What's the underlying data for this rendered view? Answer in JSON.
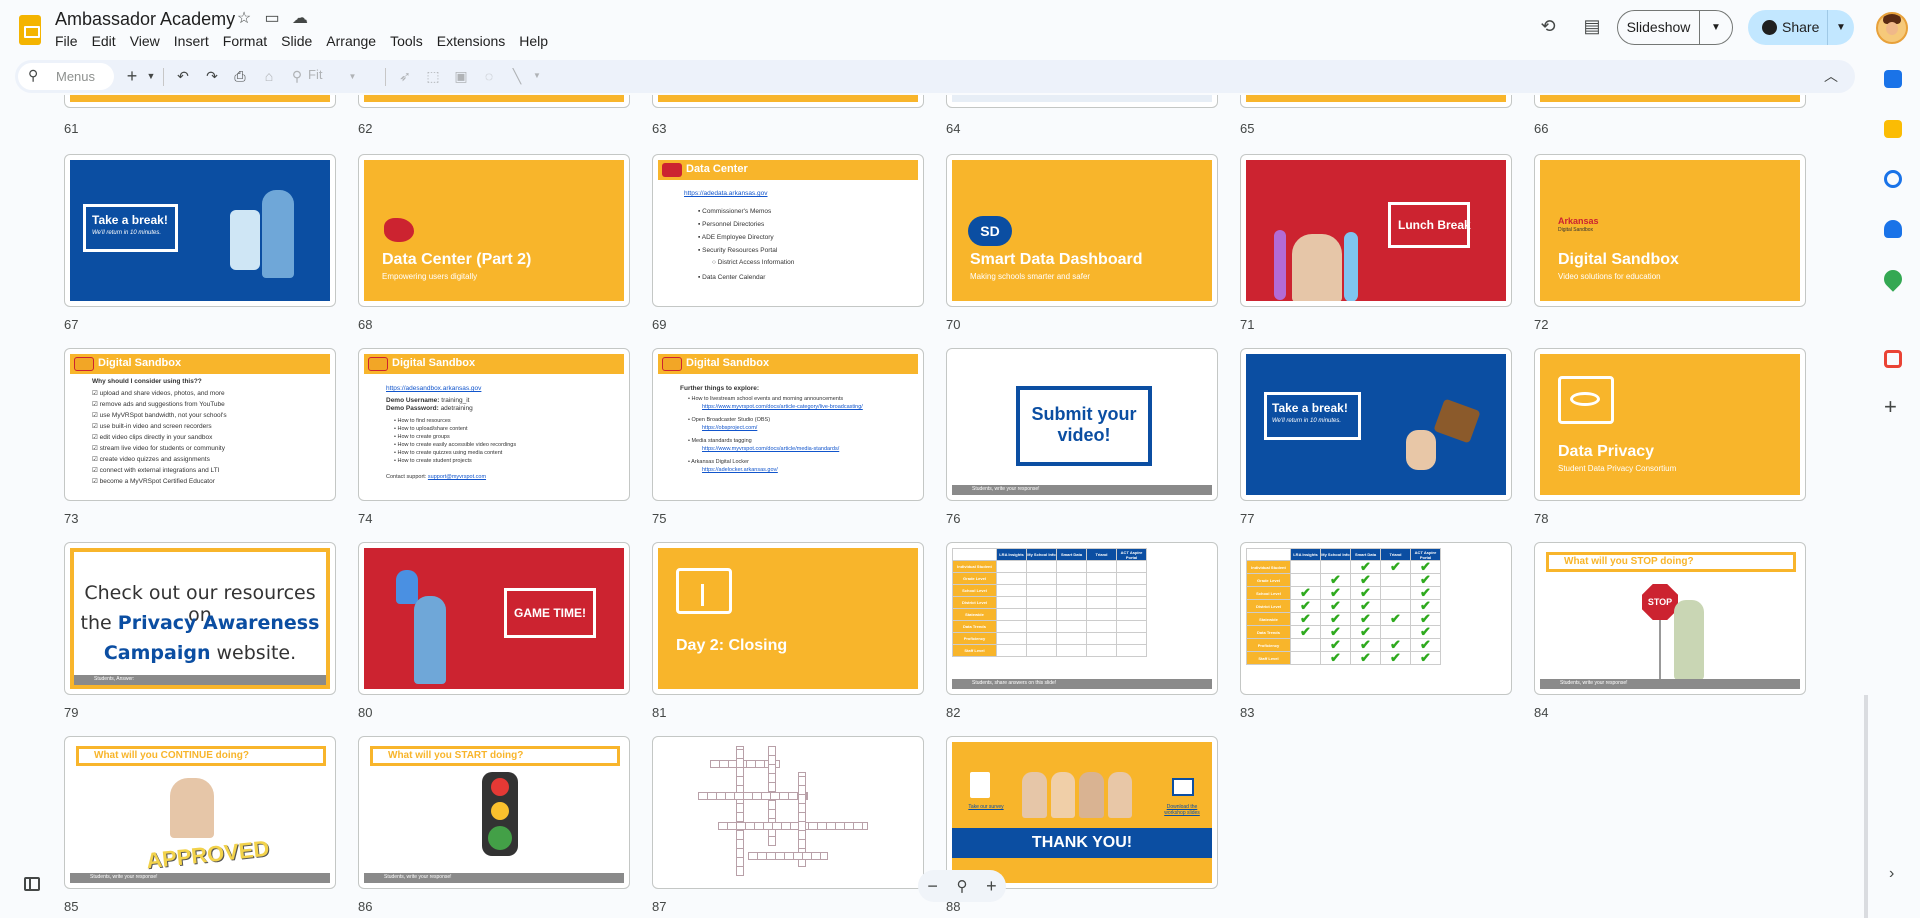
{
  "document": {
    "title": "Ambassador Academy"
  },
  "menubar": [
    "File",
    "Edit",
    "View",
    "Insert",
    "Format",
    "Slide",
    "Arrange",
    "Tools",
    "Extensions",
    "Help"
  ],
  "header_buttons": {
    "slideshow": "Slideshow",
    "share": "Share"
  },
  "toolbar": {
    "search_label": "Menus",
    "zoom_value": "Fit"
  },
  "top_row_numbers": [
    "61",
    "62",
    "63",
    "64",
    "65",
    "66"
  ],
  "slides": {
    "s67": {
      "num": "67",
      "title": "Take a break!",
      "sub": "We'll return in 10 minutes."
    },
    "s68": {
      "num": "68",
      "title": "Data Center (Part 2)",
      "sub": "Empowering users digitally"
    },
    "s69": {
      "num": "69",
      "title": "Data Center",
      "link": "https://adedata.arkansas.gov",
      "bullets": [
        "Commissioner's Memos",
        "Personnel Directories",
        "ADE Employee Directory",
        "Security Resources Portal",
        "District Access Information",
        "Data Center Calendar"
      ]
    },
    "s70": {
      "num": "70",
      "badge": "SD",
      "title": "Smart Data Dashboard",
      "sub": "Making schools smarter and safer"
    },
    "s71": {
      "num": "71",
      "title": "Lunch Break"
    },
    "s72": {
      "num": "72",
      "logo": "Arkansas",
      "logo_sub": "Digital Sandbox",
      "title": "Digital Sandbox",
      "sub": "Video solutions for education"
    },
    "s73": {
      "num": "73",
      "title": "Digital Sandbox",
      "heading": "Why should I consider using this??",
      "bullets": [
        "☑ upload and share videos, photos, and more",
        "☑ remove ads and suggestions from YouTube",
        "☑ use MyVRSpot bandwidth, not your school's",
        "☑ use built-in video and screen recorders",
        "☑ edit video clips directly in your sandbox",
        "☑ stream live video for students or community",
        "☑ create video quizzes and assignments",
        "☑ connect with external integrations and LTI",
        "☑ become a MyVRSpot Certified Educator"
      ]
    },
    "s74": {
      "num": "74",
      "title": "Digital Sandbox",
      "link": "https://adesandbox.arkansas.gov",
      "user_label": "Demo Username:",
      "user_value": "training_it",
      "pass_label": "Demo Password:",
      "pass_value": "adetraining",
      "bullets": [
        "How to find resources",
        "How to upload/share content",
        "How to create groups",
        "How to create easily accessible video recordings",
        "How to create quizzes using media content",
        "How to create student projects"
      ],
      "contact_label": "Contact support:",
      "contact_link": "support@myvrspot.com"
    },
    "s75": {
      "num": "75",
      "title": "Digital Sandbox",
      "heading": "Further things to explore:",
      "items": [
        "How to livestream school events and morning announcements",
        "https://www.myvrspot.com/docs/article-category/live-broadcasting/",
        "Open Broadcaster Studio (OBS)",
        "https://obsproject.com/",
        "Media standards tagging",
        "https://www.myvrspot.com/docs/article/media-standards/",
        "Arkansas Digital Locker",
        "https://adelocker.arkansas.gov/"
      ]
    },
    "s76": {
      "num": "76",
      "title": "Submit your video!",
      "footer": "Students, write your response!"
    },
    "s77": {
      "num": "77",
      "title": "Take a break!",
      "sub": "We'll return in 10 minutes."
    },
    "s78": {
      "num": "78",
      "title": "Data Privacy",
      "sub": "Student Data Privacy Consortium"
    },
    "s79": {
      "num": "79",
      "line1": "Check out our resources on",
      "line2a": "the ",
      "line2b": "Privacy Awareness",
      "line3a": "Campaign",
      "line3b": " website.",
      "footer": "Students, Answer:"
    },
    "s80": {
      "num": "80",
      "title": "GAME TIME!"
    },
    "s81": {
      "num": "81",
      "title": "Day 2: Closing"
    },
    "s82": {
      "num": "82",
      "cols": [
        "LRA Insights",
        "My School Info",
        "Smart Data",
        "Triand",
        "ACT Aspire Portal"
      ],
      "rows": [
        "Individual Student",
        "Grade Level",
        "School Level",
        "District Level",
        "Statewide",
        "Data Trends",
        "Proficiency",
        "Staff Level"
      ],
      "footer": "Students, share answers on this slide!"
    },
    "s83": {
      "num": "83",
      "cols": [
        "LRA Insights",
        "My School Info",
        "Smart Data",
        "Triand",
        "ACT Aspire Portal"
      ],
      "rows": [
        "Individual Student",
        "Grade Level",
        "School Level",
        "District Level",
        "Statewide",
        "Data Trends",
        "Proficiency",
        "Staff Level"
      ]
    },
    "s84": {
      "num": "84",
      "title": "What will you STOP doing?",
      "sign": "STOP",
      "footer": "Students, write your response!"
    },
    "s85": {
      "num": "85",
      "title": "What will you CONTINUE doing?",
      "stamp": "APPROVED",
      "footer": "Students, write your response!"
    },
    "s86": {
      "num": "86",
      "title": "What will you START doing?",
      "footer": "Students, write your response!"
    },
    "s87": {
      "num": "87"
    },
    "s88": {
      "num": "88",
      "title": "THANK YOU!",
      "left_link": "Take our survey",
      "right_link": "Download the workshop slides"
    }
  },
  "colors": {
    "yellow": "#f8b52b",
    "blue": "#0b4ea2",
    "red": "#cc2330",
    "share_bg": "#c2e7ff",
    "toolbar_bg": "#edf2fa"
  },
  "icons": [
    "search-icon",
    "star-icon",
    "folder-icon",
    "cloud-icon",
    "history-icon",
    "comment-icon",
    "globe-icon",
    "undo-icon",
    "redo-icon",
    "print-icon",
    "paint-format-icon",
    "zoom-icon",
    "cursor-icon",
    "select-icon",
    "image-icon",
    "shape-icon",
    "line-icon",
    "chevron-up-icon",
    "calendar-icon",
    "keep-icon",
    "tasks-icon",
    "contacts-icon",
    "maps-icon",
    "office-icon",
    "plus-icon",
    "zoom-out-icon",
    "zoom-in-icon"
  ]
}
